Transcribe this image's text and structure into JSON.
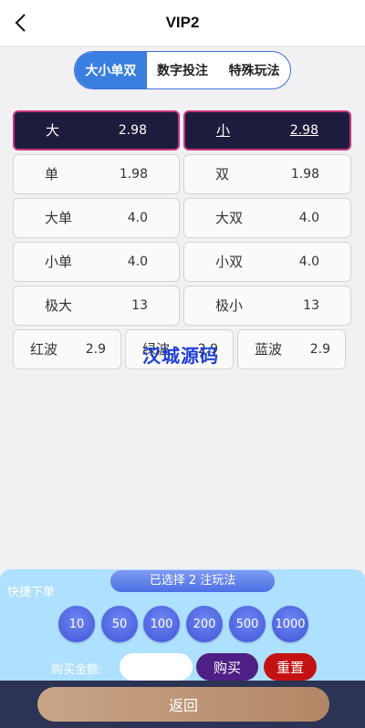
{
  "header": {
    "title": "VIP2"
  },
  "tabs": [
    {
      "label": "大小单双",
      "active": true
    },
    {
      "label": "数字投注",
      "active": false
    },
    {
      "label": "特殊玩法",
      "active": false
    }
  ],
  "bets": [
    {
      "name": "大",
      "odds": "2.98",
      "selected": true
    },
    {
      "name": "小",
      "odds": "2.98",
      "selected": true
    },
    {
      "name": "单",
      "odds": "1.98",
      "selected": false
    },
    {
      "name": "双",
      "odds": "1.98",
      "selected": false
    },
    {
      "name": "大单",
      "odds": "4.0",
      "selected": false
    },
    {
      "name": "大双",
      "odds": "4.0",
      "selected": false
    },
    {
      "name": "小单",
      "odds": "4.0",
      "selected": false
    },
    {
      "name": "小双",
      "odds": "4.0",
      "selected": false
    },
    {
      "name": "极大",
      "odds": "13",
      "selected": false
    },
    {
      "name": "极小",
      "odds": "13",
      "selected": false
    },
    {
      "name": "红波",
      "odds": "2.9",
      "selected": false
    },
    {
      "name": "绿波",
      "odds": "2.9",
      "selected": false
    },
    {
      "name": "蓝波",
      "odds": "2.9",
      "selected": false
    }
  ],
  "watermark": "汉城源码",
  "bottom": {
    "selected_text": "已选择 2 注玩法",
    "quick_label": "快捷下单",
    "chips": [
      "10",
      "50",
      "100",
      "200",
      "500",
      "1000"
    ],
    "amount_label": "购买金额:",
    "amount_value": "",
    "buy_label": "购买",
    "reset_label": "重置"
  },
  "footer": {
    "return_label": "返回"
  },
  "colors": {
    "accent": "#3a7ee0",
    "selected_bg": "#1e1c3c",
    "selected_border": "#c8357f",
    "buy": "#4f1f86",
    "reset": "#c41212"
  }
}
